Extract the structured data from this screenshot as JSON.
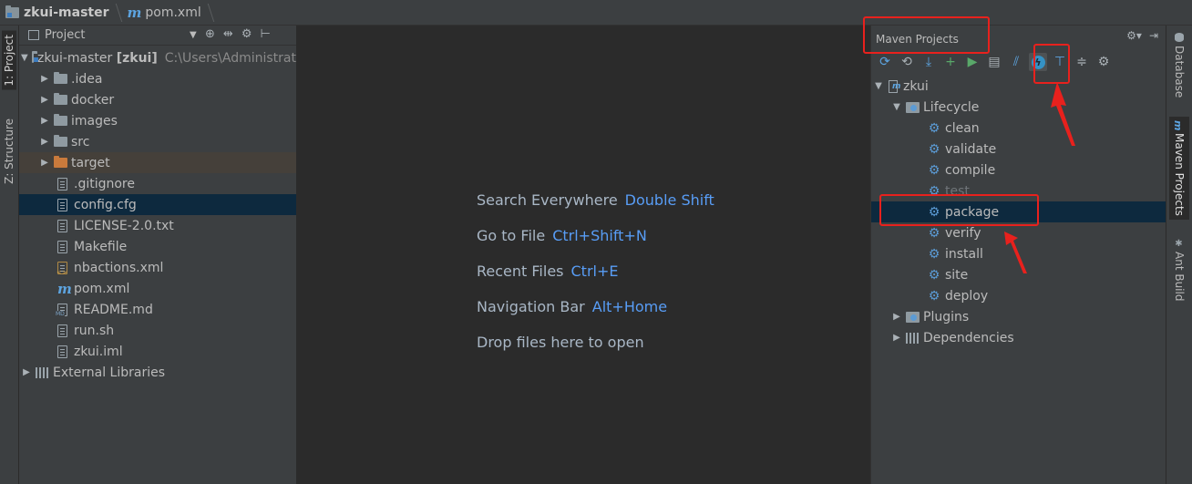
{
  "breadcrumb": {
    "project": "zkui-master",
    "file": "pom.xml"
  },
  "left_strip": {
    "project_tab": "1: Project",
    "structure_tab": "Z: Structure"
  },
  "project_panel": {
    "title": "Project",
    "root": {
      "name": "zkui-master",
      "module": "[zkui]",
      "path": "C:\\Users\\Administrat"
    },
    "folders": [
      ".idea",
      "docker",
      "images",
      "src",
      "target"
    ],
    "files": [
      ".gitignore",
      "config.cfg",
      "LICENSE-2.0.txt",
      "Makefile",
      "nbactions.xml",
      "pom.xml",
      "README.md",
      "run.sh",
      "zkui.iml"
    ],
    "external": "External Libraries"
  },
  "editor_hints": [
    {
      "label": "Search Everywhere",
      "key": "Double Shift"
    },
    {
      "label": "Go to File",
      "key": "Ctrl+Shift+N"
    },
    {
      "label": "Recent Files",
      "key": "Ctrl+E"
    },
    {
      "label": "Navigation Bar",
      "key": "Alt+Home"
    },
    {
      "label": "Drop files here to open",
      "key": ""
    }
  ],
  "maven_panel": {
    "title": "Maven Projects",
    "project": "zkui",
    "lifecycle": "Lifecycle",
    "phases": [
      "clean",
      "validate",
      "compile",
      "test",
      "package",
      "verify",
      "install",
      "site",
      "deploy"
    ],
    "selected_phase": "package",
    "plugins": "Plugins",
    "dependencies": "Dependencies"
  },
  "right_strip": {
    "database_tab": "Database",
    "maven_tab": "Maven Projects",
    "ant_tab": "Ant Build"
  },
  "colors": {
    "accent_link": "#589df6",
    "selection": "#0d293e",
    "annotation_red": "#e8211d",
    "panel_bg": "#3c3f41",
    "editor_bg": "#2b2b2b"
  }
}
